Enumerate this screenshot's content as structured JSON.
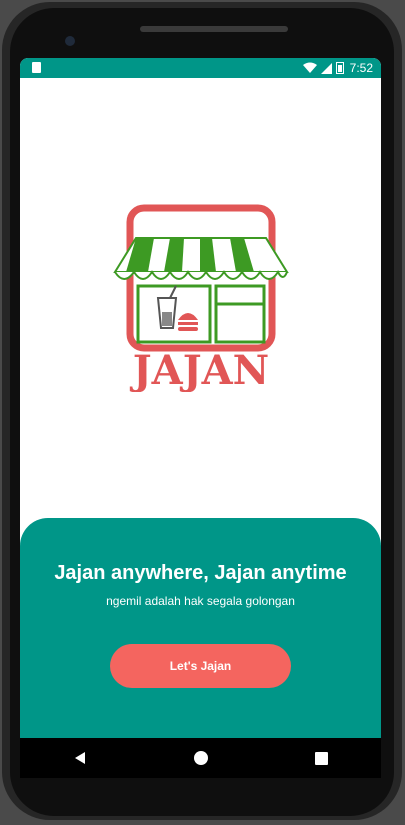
{
  "status_bar": {
    "time": "7:52"
  },
  "logo": {
    "text": "JAJAN"
  },
  "panel": {
    "title": "Jajan anywhere, Jajan anytime",
    "subtitle": "ngemil adalah hak segala golongan",
    "button_label": "Let's Jajan"
  },
  "colors": {
    "primary": "#009688",
    "button": "#f4655f",
    "logo_red": "#e15656",
    "logo_green": "#3d9a23"
  },
  "nav": {
    "icons": [
      "back-icon",
      "home-icon",
      "recents-icon"
    ]
  }
}
